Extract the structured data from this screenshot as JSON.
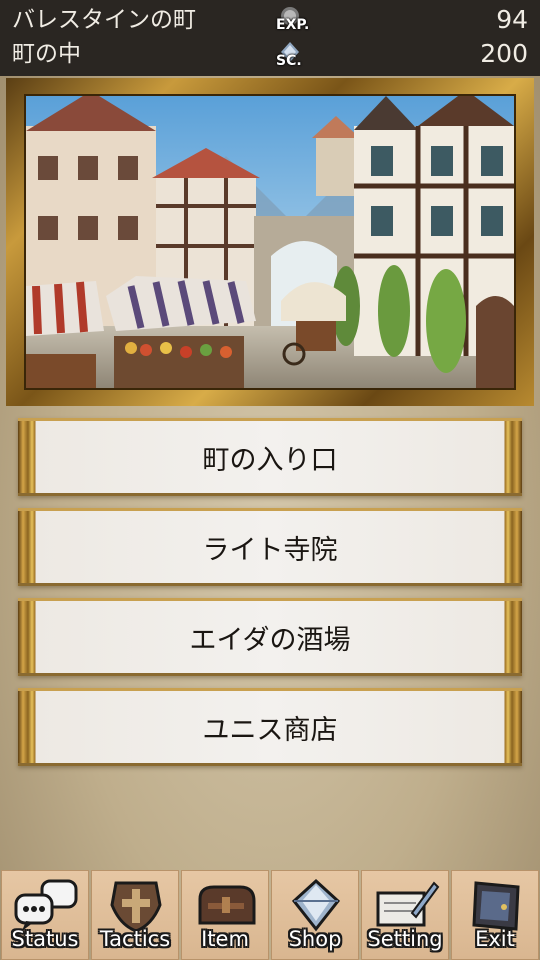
{
  "header": {
    "town": "バレスタインの町",
    "area": "町の中",
    "exp_label": "EXP.",
    "exp_value": "94",
    "sc_label": "SC.",
    "sc_value": "200"
  },
  "scene": {
    "description_icon": "town-street-illustration"
  },
  "locations": [
    {
      "label": "町の入り口"
    },
    {
      "label": "ライト寺院"
    },
    {
      "label": "エイダの酒場"
    },
    {
      "label": "ユニス商店"
    }
  ],
  "menu": [
    {
      "label": "Status",
      "icon": "speech-bubbles-icon"
    },
    {
      "label": "Tactics",
      "icon": "cross-shield-icon"
    },
    {
      "label": "Item",
      "icon": "bag-icon"
    },
    {
      "label": "Shop",
      "icon": "crystal-icon"
    },
    {
      "label": "Setting",
      "icon": "quill-scroll-icon"
    },
    {
      "label": "Exit",
      "icon": "exit-door-icon"
    }
  ],
  "colors": {
    "header_bg": "#2a2622",
    "frame_gold": "#c89a3c",
    "button_face": "#f3f1ee"
  }
}
